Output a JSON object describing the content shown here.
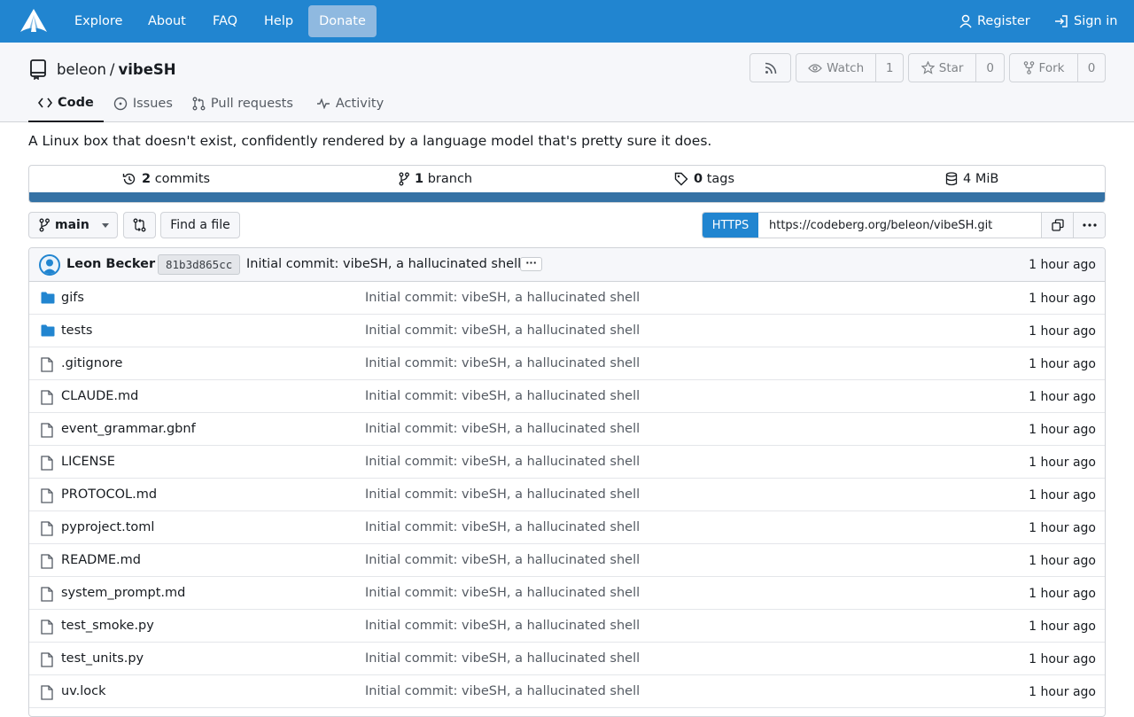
{
  "nav": {
    "items": [
      "Explore",
      "About",
      "FAQ",
      "Help"
    ],
    "donate": "Donate",
    "register": "Register",
    "sign_in": "Sign in"
  },
  "repo": {
    "owner": "beleon",
    "separator": "/",
    "name": "vibeSH",
    "watch_label": "Watch",
    "watch_count": "1",
    "star_label": "Star",
    "star_count": "0",
    "fork_label": "Fork",
    "fork_count": "0",
    "description": "A Linux box that doesn't exist, confidently rendered by a language model that's pretty sure it does."
  },
  "tabs": {
    "code": "Code",
    "issues": "Issues",
    "pulls": "Pull requests",
    "activity": "Activity"
  },
  "stats": {
    "commits_num": "2",
    "commits_label": "commits",
    "branch_num": "1",
    "branch_label": "branch",
    "tags_num": "0",
    "tags_label": "tags",
    "size": "4 MiB"
  },
  "language_bar_color": "#3572a5",
  "branch": {
    "name": "main",
    "find_file": "Find a file",
    "protocol": "HTTPS",
    "clone_url": "https://codeberg.org/beleon/vibeSH.git"
  },
  "latest_commit": {
    "author": "Leon Becker",
    "sha": "81b3d865cc",
    "message": "Initial commit: vibeSH, a hallucinated shell",
    "ellipsis": "···",
    "time": "1 hour ago"
  },
  "files": [
    {
      "name": "gifs",
      "type": "folder",
      "message": "Initial commit: vibeSH, a hallucinated shell",
      "time": "1 hour ago"
    },
    {
      "name": "tests",
      "type": "folder",
      "message": "Initial commit: vibeSH, a hallucinated shell",
      "time": "1 hour ago"
    },
    {
      "name": ".gitignore",
      "type": "file",
      "message": "Initial commit: vibeSH, a hallucinated shell",
      "time": "1 hour ago"
    },
    {
      "name": "CLAUDE.md",
      "type": "file",
      "message": "Initial commit: vibeSH, a hallucinated shell",
      "time": "1 hour ago"
    },
    {
      "name": "event_grammar.gbnf",
      "type": "file",
      "message": "Initial commit: vibeSH, a hallucinated shell",
      "time": "1 hour ago"
    },
    {
      "name": "LICENSE",
      "type": "file",
      "message": "Initial commit: vibeSH, a hallucinated shell",
      "time": "1 hour ago"
    },
    {
      "name": "PROTOCOL.md",
      "type": "file",
      "message": "Initial commit: vibeSH, a hallucinated shell",
      "time": "1 hour ago"
    },
    {
      "name": "pyproject.toml",
      "type": "file",
      "message": "Initial commit: vibeSH, a hallucinated shell",
      "time": "1 hour ago"
    },
    {
      "name": "README.md",
      "type": "file",
      "message": "Initial commit: vibeSH, a hallucinated shell",
      "time": "1 hour ago"
    },
    {
      "name": "system_prompt.md",
      "type": "file",
      "message": "Initial commit: vibeSH, a hallucinated shell",
      "time": "1 hour ago"
    },
    {
      "name": "test_smoke.py",
      "type": "file",
      "message": "Initial commit: vibeSH, a hallucinated shell",
      "time": "1 hour ago"
    },
    {
      "name": "test_units.py",
      "type": "file",
      "message": "Initial commit: vibeSH, a hallucinated shell",
      "time": "1 hour ago"
    },
    {
      "name": "uv.lock",
      "type": "file",
      "message": "Initial commit: vibeSH, a hallucinated shell",
      "time": "1 hour ago"
    }
  ]
}
